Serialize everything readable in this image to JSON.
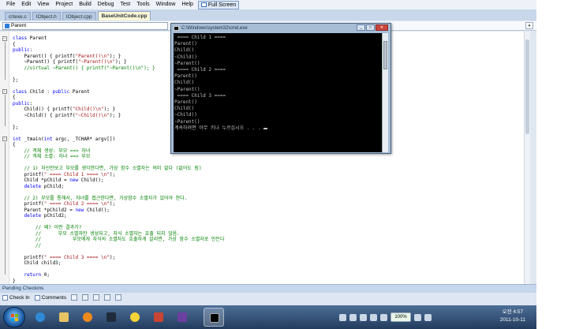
{
  "menu": {
    "items": [
      "File",
      "Edit",
      "View",
      "Project",
      "Build",
      "Debug",
      "Test",
      "Tools",
      "Window",
      "Help"
    ],
    "full_screen": "Full Screen"
  },
  "tabs": [
    {
      "label": "crtexe.c"
    },
    {
      "label": "IObject.h"
    },
    {
      "label": "IObject.cpp"
    },
    {
      "label": "BaseUnitCode.cpp",
      "active": true
    }
  ],
  "nav": {
    "scope": "Parent"
  },
  "code_lines": [
    "class Parent",
    "{",
    "public:",
    "    Parent() { printf(\"Parent()\\n\"); }",
    "    ~Parent() { printf(\"~Parent()\\n\"); }",
    "    //virtual ~Parent() { printf(\"~Parent()\\n\"); }",
    "",
    "};",
    "",
    "class Child : public Parent",
    "{",
    "public:",
    "    Child() { printf(\"Child()\\n\"); }",
    "    ~Child() { printf(\"~Child()\\n\"); }",
    "",
    "};",
    "",
    "int _tmain(int argc, _TCHAR* argv[])",
    "{",
    "    // 객체 생성: 부모 ==> 자녀",
    "    // 객체 소멸: 자녀 ==> 부모",
    "",
    "    // 1) 자신만보고 부모를 생각한다면, 가상 함수 소멸자는 의미 없다 (없어도 됨)",
    "    printf(\" ==== Child 1 ==== \\n\");",
    "    Child *pChild = new Child();",
    "    delete pChild;",
    "",
    "    // 2) 부모를 통해서, 자녀를 접근한다면, 가상함수 소멸자가 있어야 한다.",
    "    printf(\" ==== Child 2 ==== \\n\");",
    "    Parent *pChild2 = new Child();",
    "    delete pChild2;",
    "",
    "        // 왜? 이런 결과가?",
    "        //      부모 소멸자만 생성되고, 자식 소멸자는 호출 되지 않음.",
    "        //           부모에게 자식의 소멸자도 호출하게 알리면, 가상 함수 소멸자로 만든다",
    "        //",
    "",
    "    printf(\" ==== Child 3 ==== \\n\");",
    "    Child child3;",
    "",
    "    return 0;",
    "}"
  ],
  "cmd": {
    "title": "C:\\Windows\\system32\\cmd.exe",
    "lines": [
      " ==== Child 1 ====",
      "Parent()",
      "Child()",
      "~Child()",
      "~Parent()",
      " ==== Child 2 ====",
      "Parent()",
      "Child()",
      "~Parent()",
      " ==== Child 3 ====",
      "Parent()",
      "Child()",
      "~Child()",
      "~Parent()",
      "계속하려면 아무 키나 누르십시오 . . ."
    ]
  },
  "pending": {
    "title": "Pending Checkins",
    "check_in": "Check In",
    "comments": "Comments"
  },
  "taskbar": {
    "zoom": "100%",
    "time": "오전 4:57",
    "date": "2011-10-11"
  },
  "colors": {
    "keyword": "#0000ff",
    "comment": "#008000",
    "string": "#a31515",
    "console_bg": "#000000",
    "console_fg": "#c0c0c0"
  }
}
